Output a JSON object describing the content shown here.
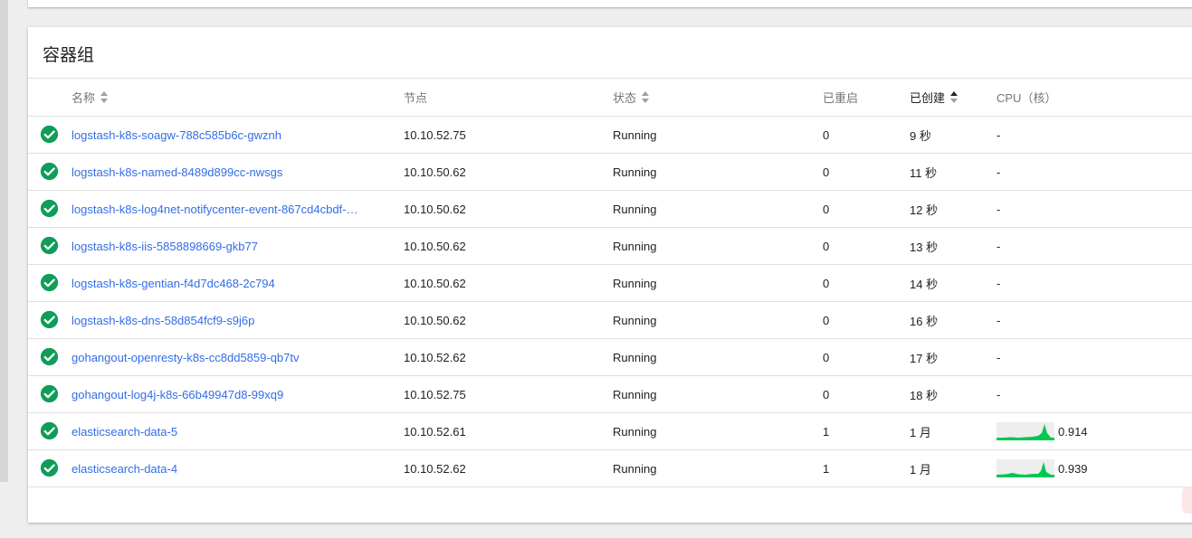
{
  "card": {
    "title": "容器组"
  },
  "columns": {
    "name": "名称",
    "node": "节点",
    "status": "状态",
    "restarts": "已重启",
    "created": "已创建",
    "cpu": "CPU（核）"
  },
  "colors": {
    "link": "#326de6",
    "status_ok": "#0f9d58",
    "sparkline": "#00c752"
  },
  "icons": {
    "status": "check-circle-icon"
  },
  "pods": [
    {
      "name": "logstash-k8s-soagw-788c585b6c-gwznh",
      "node": "10.10.52.75",
      "status": "Running",
      "restarts": "0",
      "age": "9 秒",
      "cpu": "-"
    },
    {
      "name": "logstash-k8s-named-8489d899cc-nwsgs",
      "node": "10.10.50.62",
      "status": "Running",
      "restarts": "0",
      "age": "11 秒",
      "cpu": "-"
    },
    {
      "name": "logstash-k8s-log4net-notifycenter-event-867cd4cbdf-…",
      "node": "10.10.50.62",
      "status": "Running",
      "restarts": "0",
      "age": "12 秒",
      "cpu": "-"
    },
    {
      "name": "logstash-k8s-iis-5858898669-gkb77",
      "node": "10.10.50.62",
      "status": "Running",
      "restarts": "0",
      "age": "13 秒",
      "cpu": "-"
    },
    {
      "name": "logstash-k8s-gentian-f4d7dc468-2c794",
      "node": "10.10.50.62",
      "status": "Running",
      "restarts": "0",
      "age": "14 秒",
      "cpu": "-"
    },
    {
      "name": "logstash-k8s-dns-58d854fcf9-s9j6p",
      "node": "10.10.50.62",
      "status": "Running",
      "restarts": "0",
      "age": "16 秒",
      "cpu": "-"
    },
    {
      "name": "gohangout-openresty-k8s-cc8dd5859-qb7tv",
      "node": "10.10.52.62",
      "status": "Running",
      "restarts": "0",
      "age": "17 秒",
      "cpu": "-"
    },
    {
      "name": "gohangout-log4j-k8s-66b49947d8-99xq9",
      "node": "10.10.52.75",
      "status": "Running",
      "restarts": "0",
      "age": "18 秒",
      "cpu": "-"
    },
    {
      "name": "elasticsearch-data-5",
      "node": "10.10.52.61",
      "status": "Running",
      "restarts": "1",
      "age": "1 月",
      "cpu": "0.914"
    },
    {
      "name": "elasticsearch-data-4",
      "node": "10.10.52.62",
      "status": "Running",
      "restarts": "1",
      "age": "1 月",
      "cpu": "0.939"
    }
  ]
}
